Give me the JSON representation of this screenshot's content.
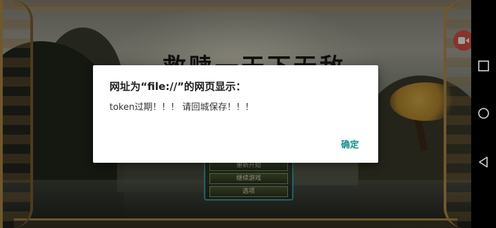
{
  "game": {
    "title": "救赎一天下无敌",
    "menu_items": [
      "重新开始",
      "继续游戏",
      "选项"
    ],
    "record_icon": "video-record-icon"
  },
  "dialog": {
    "title": "网址为“file://”的网页显示：",
    "message": "token过期！！！ 请回城保存！！！",
    "ok_label": "确定"
  },
  "navbar": {
    "icons": [
      "recents-square-icon",
      "home-circle-icon",
      "back-triangle-icon"
    ]
  },
  "colors": {
    "dialog_accent": "#128b8b",
    "record_button": "#d9534a",
    "frame_gold": "#b58f4a"
  }
}
